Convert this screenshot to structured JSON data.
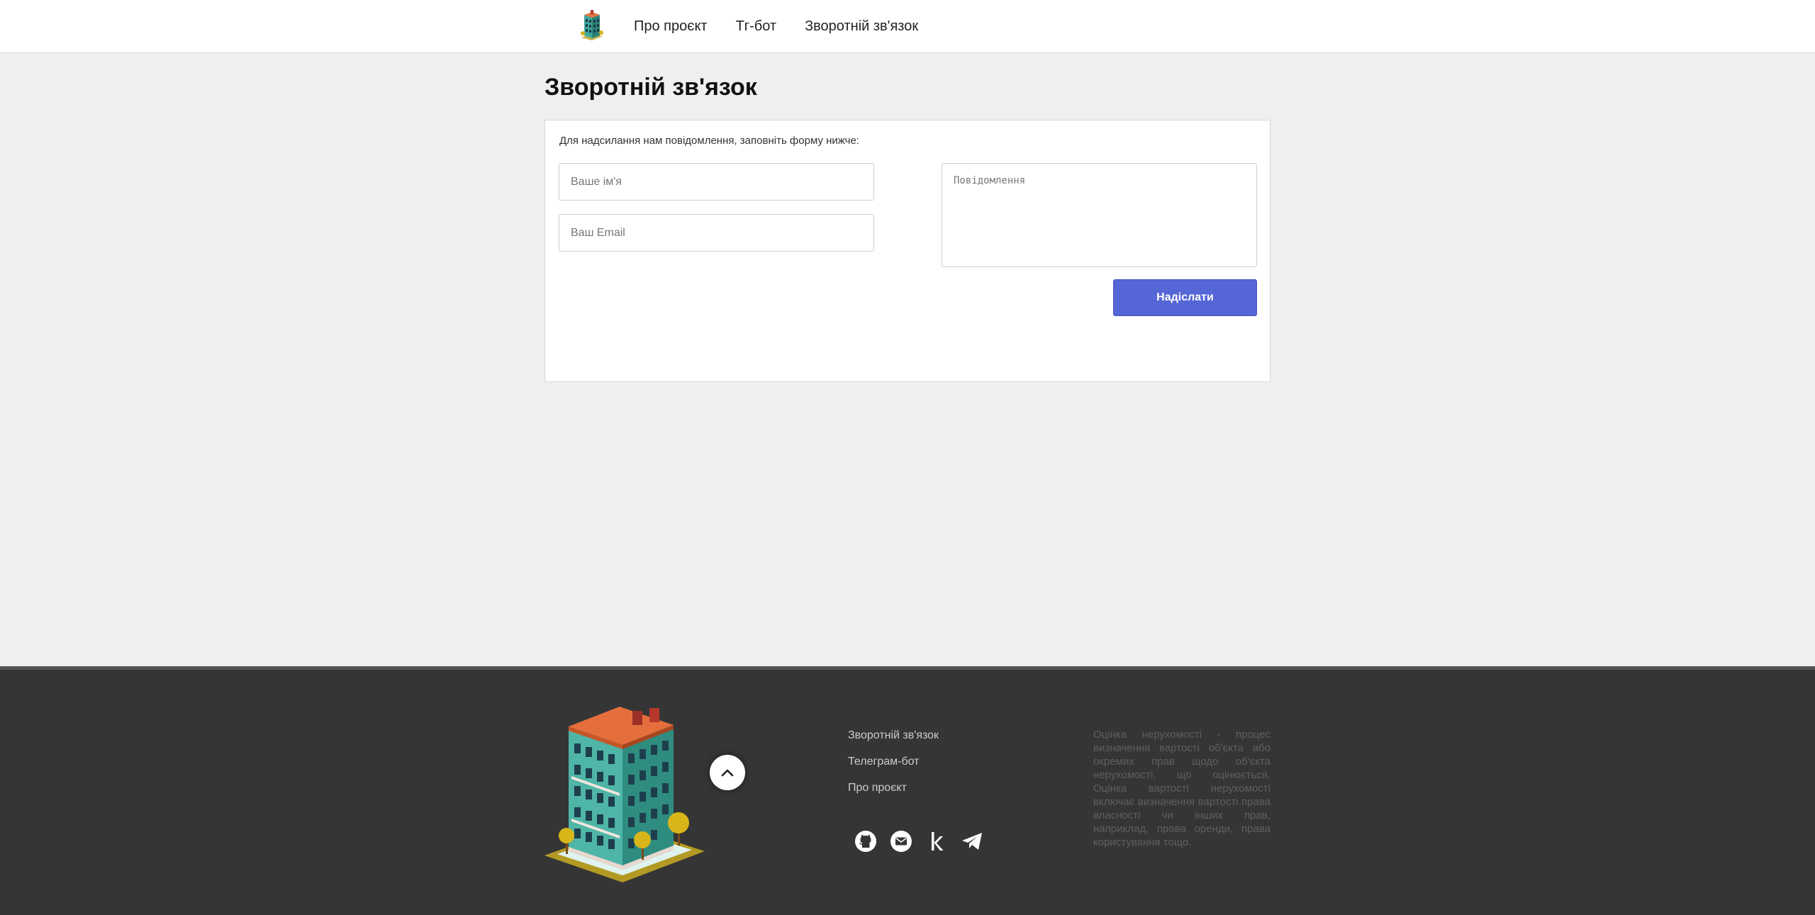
{
  "header": {
    "nav": [
      {
        "label": "Про проєкт"
      },
      {
        "label": "Тг-бот"
      },
      {
        "label": "Зворотній зв'язок"
      }
    ]
  },
  "main": {
    "title": "Зворотній зв'язок",
    "intro": "Для надсилання нам повідомлення, заповніть форму нижче:",
    "form": {
      "name_placeholder": "Ваше ім'я",
      "email_placeholder": "Ваш Email",
      "message_placeholder": "Повідомлення",
      "submit_label": "Надіслати"
    },
    "colors": {
      "accent": "#5566d6"
    }
  },
  "footer": {
    "links": [
      {
        "label": "Зворотній зв'язок"
      },
      {
        "label": "Телеграм-бот"
      },
      {
        "label": "Про проєкт"
      }
    ],
    "social_icons": [
      "github-icon",
      "email-icon",
      "kaggle-icon",
      "telegram-icon"
    ],
    "description": "Оцінка нерухомості - процес визначення вартості об'єкта або окремих прав щодо об'єкта нерухомості, що оцінюється. Оцінка вартості нерухомості включає визначення вартості права власності чи інших прав, наприклад, права оренди, права користування тощо.",
    "colors": {
      "background": "#353535"
    }
  }
}
